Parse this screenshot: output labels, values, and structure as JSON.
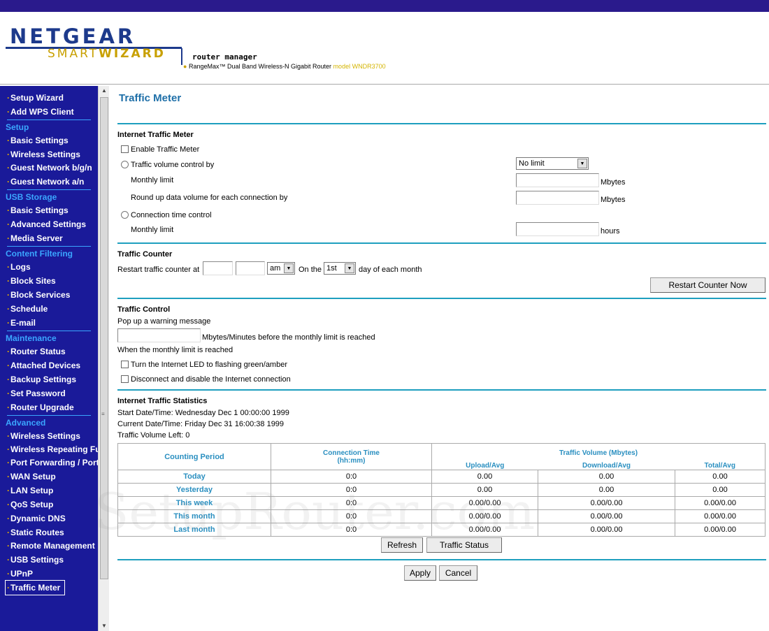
{
  "header": {
    "logo_top": "NETGEAR",
    "logo_smart": "SMART",
    "logo_wizard": "WIZARD",
    "app_name": "router manager",
    "subtitle": "RangeMax™ Dual Band Wireless-N Gigabit Router",
    "model": "model WNDR3700",
    "brand_color": "#1d3a8c",
    "accent_color": "#c8a000"
  },
  "sidebar": {
    "bg_color": "#1a1a99",
    "top_items": [
      {
        "label": "Setup Wizard"
      },
      {
        "label": "Add WPS Client"
      }
    ],
    "groups": [
      {
        "title": "Setup",
        "items": [
          "Basic Settings",
          "Wireless Settings",
          "Guest Network b/g/n",
          "Guest Network a/n"
        ]
      },
      {
        "title": "USB Storage",
        "items": [
          "Basic Settings",
          "Advanced Settings",
          "Media Server"
        ]
      },
      {
        "title": "Content Filtering",
        "items": [
          "Logs",
          "Block Sites",
          "Block Services",
          "Schedule",
          "E-mail"
        ]
      },
      {
        "title": "Maintenance",
        "items": [
          "Router Status",
          "Attached Devices",
          "Backup Settings",
          "Set Password",
          "Router Upgrade"
        ]
      },
      {
        "title": "Advanced",
        "items": [
          "Wireless Settings",
          "Wireless Repeating Function",
          "Port Forwarding / Port Triggering",
          "WAN Setup",
          "LAN Setup",
          "QoS Setup",
          "Dynamic DNS",
          "Static Routes",
          "Remote Management",
          "USB Settings",
          "UPnP",
          "Traffic Meter"
        ]
      }
    ],
    "active_item": "Traffic Meter"
  },
  "page": {
    "title": "Traffic Meter",
    "accent_color": "#1e9fbf"
  },
  "internet_traffic_meter": {
    "heading": "Internet Traffic Meter",
    "enable_label": "Enable Traffic Meter",
    "volume_control_label": "Traffic volume control by",
    "volume_control_value": "No limit",
    "monthly_limit_label": "Monthly limit",
    "monthly_limit_value": "",
    "monthly_limit_unit": "Mbytes",
    "roundup_label": "Round up data volume for each connection by",
    "roundup_value": "",
    "roundup_unit": "Mbytes",
    "time_control_label": "Connection time control",
    "time_monthly_label": "Monthly limit",
    "time_monthly_value": "",
    "time_unit": "hours"
  },
  "traffic_counter": {
    "heading": "Traffic Counter",
    "restart_label": "Restart traffic counter at",
    "hour_value": "",
    "minute_value": "",
    "ampm_value": "am",
    "on_the_label": "On the",
    "day_value": "1st",
    "day_suffix": "day of each month",
    "restart_now_button": "Restart Counter Now"
  },
  "traffic_control": {
    "heading": "Traffic Control",
    "popup_label": "Pop up a warning message",
    "popup_value": "",
    "popup_suffix": "Mbytes/Minutes before the monthly limit is reached",
    "when_reached_label": "When the monthly limit is reached",
    "led_label": "Turn the Internet LED to flashing green/amber",
    "disconnect_label": "Disconnect and disable the Internet connection"
  },
  "statistics": {
    "heading": "Internet Traffic Statistics",
    "start_label": "Start Date/Time: Wednesday Dec 1 00:00:00 1999",
    "current_label": "Current Date/Time: Friday Dec 31 16:00:38 1999",
    "volume_left_label": "Traffic Volume Left: 0",
    "table": {
      "col_period": "Counting Period",
      "col_conn_time": "Connection Time (hh:mm)",
      "col_volume": "Traffic Volume (Mbytes)",
      "col_upload": "Upload/Avg",
      "col_download": "Download/Avg",
      "col_total": "Total/Avg",
      "rows": [
        {
          "period": "Today",
          "time": "0:0",
          "upload": "0.00",
          "download": "0.00",
          "total": "0.00"
        },
        {
          "period": "Yesterday",
          "time": "0:0",
          "upload": "0.00",
          "download": "0.00",
          "total": "0.00"
        },
        {
          "period": "This week",
          "time": "0:0",
          "upload": "0.00/0.00",
          "download": "0.00/0.00",
          "total": "0.00/0.00"
        },
        {
          "period": "This month",
          "time": "0:0",
          "upload": "0.00/0.00",
          "download": "0.00/0.00",
          "total": "0.00/0.00"
        },
        {
          "period": "Last month",
          "time": "0:0",
          "upload": "0.00/0.00",
          "download": "0.00/0.00",
          "total": "0.00/0.00"
        }
      ]
    },
    "refresh_button": "Refresh",
    "status_button": "Traffic Status"
  },
  "footer": {
    "apply_button": "Apply",
    "cancel_button": "Cancel"
  },
  "watermark": "SetupRouter.com"
}
